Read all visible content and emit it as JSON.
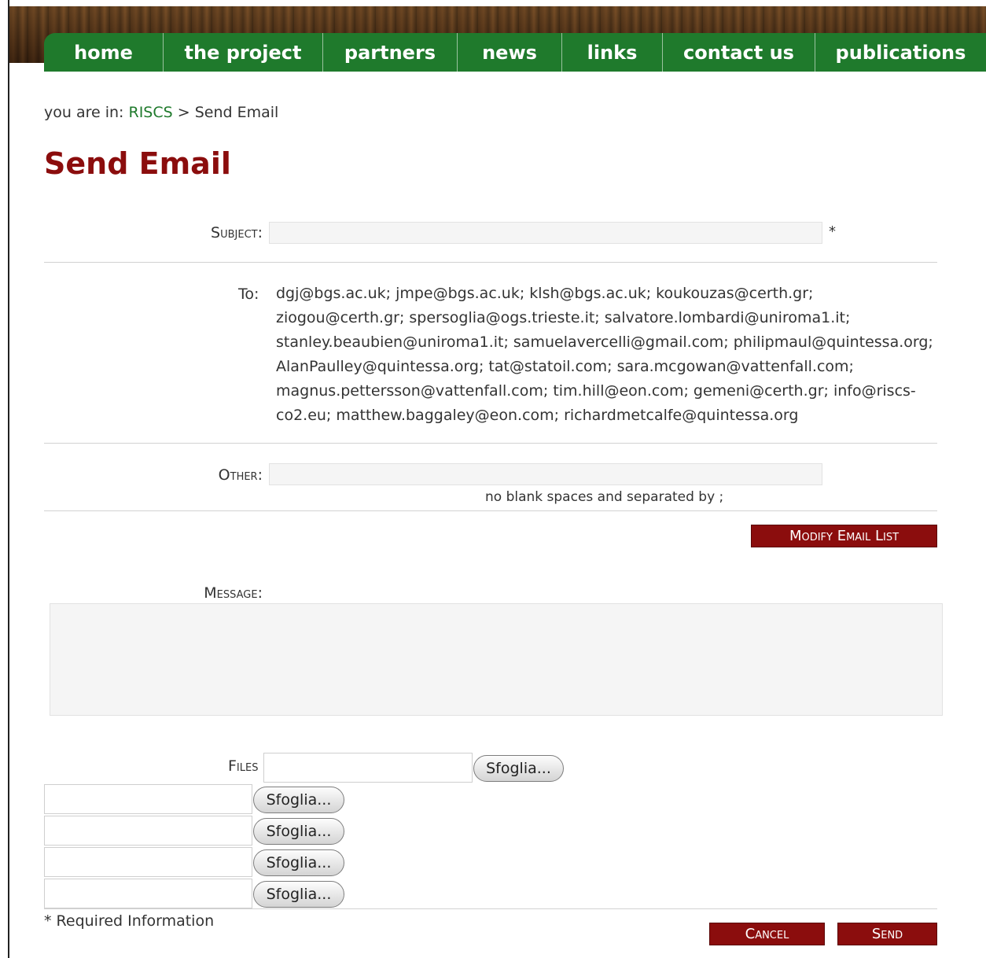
{
  "nav": {
    "items": [
      {
        "label": "home"
      },
      {
        "label": "the project"
      },
      {
        "label": "partners"
      },
      {
        "label": "news"
      },
      {
        "label": "links"
      },
      {
        "label": "contact us"
      },
      {
        "label": "publications"
      }
    ]
  },
  "breadcrumb": {
    "prefix": "you are in:",
    "root": "RISCS",
    "separator": ">",
    "current": "Send Email"
  },
  "page": {
    "title": "Send Email"
  },
  "form": {
    "subject_label": "Subject:",
    "subject_value": "",
    "required_marker": "*",
    "to_label": "To:",
    "to_recipients": "dgj@bgs.ac.uk; jmpe@bgs.ac.uk; klsh@bgs.ac.uk; koukouzas@certh.gr; ziogou@certh.gr; spersoglia@ogs.trieste.it; salvatore.lombardi@uniroma1.it; stanley.beaubien@uniroma1.it; samuelavercelli@gmail.com; philipmaul@quintessa.org; AlanPaulley@quintessa.org; tat@statoil.com; sara.mcgowan@vattenfall.com; magnus.pettersson@vattenfall.com; tim.hill@eon.com; gemeni@certh.gr; info@riscs-co2.eu; matthew.baggaley@eon.com; richardmetcalfe@quintessa.org",
    "other_label": "Other:",
    "other_value": "",
    "other_hint": "no blank spaces and separated by ;",
    "modify_button": "Modify Email List",
    "message_label": "Message:",
    "message_value": "",
    "files_label": "Files",
    "browse_label": "Sfoglia...",
    "required_note": "* Required Information",
    "cancel_button": "Cancel",
    "send_button": "Send"
  },
  "colors": {
    "nav_green": "#1f7a2c",
    "title_red": "#8b0d0d",
    "link_green": "#1f7a2c",
    "button_red": "#8b0d0d"
  }
}
